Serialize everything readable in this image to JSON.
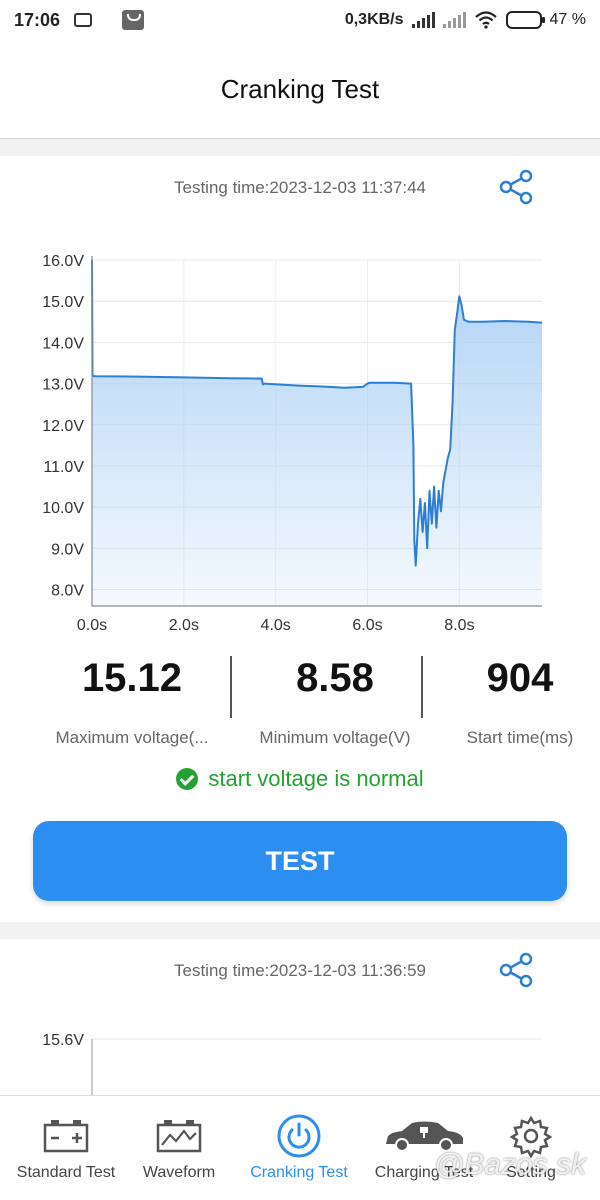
{
  "statusbar": {
    "time": "17:06",
    "net_speed": "0,3KB/s",
    "battery": "47 %"
  },
  "header": {
    "title": "Cranking Test"
  },
  "records": [
    {
      "testing_time": "Testing time:2023-12-03 11:37:44",
      "stats": {
        "max_value": "15.12",
        "max_label": "Maximum voltage(...",
        "min_value": "8.58",
        "min_label": "Minimum voltage(V)",
        "start_value": "904",
        "start_label": "Start time(ms)"
      },
      "status_text": "start voltage is normal",
      "test_button": "TEST"
    },
    {
      "testing_time": "Testing time:2023-12-03 11:36:59",
      "first_tick": "15.6V"
    }
  ],
  "chart_data": {
    "type": "area",
    "x_unit": "s",
    "y_unit": "V",
    "xlim": [
      0,
      9.8
    ],
    "ylim": [
      7.6,
      16.0
    ],
    "y_ticks": [
      "16.0V",
      "15.0V",
      "14.0V",
      "13.0V",
      "12.0V",
      "11.0V",
      "10.0V",
      "9.0V",
      "8.0V"
    ],
    "x_ticks": [
      "0.0s",
      "2.0s",
      "4.0s",
      "6.0s",
      "8.0s"
    ],
    "line_color": "#2b7fd4",
    "fill_color": "#a9cff5",
    "x": [
      0,
      0.01,
      0.05,
      1.0,
      2.0,
      3.0,
      3.7,
      3.72,
      3.75,
      4.5,
      5.0,
      5.5,
      5.9,
      6.0,
      6.05,
      6.6,
      6.95,
      7.0,
      7.02,
      7.05,
      7.1,
      7.15,
      7.2,
      7.25,
      7.3,
      7.35,
      7.4,
      7.45,
      7.5,
      7.55,
      7.6,
      7.65,
      7.7,
      7.75,
      7.8,
      7.85,
      7.9,
      7.95,
      8.0,
      8.05,
      8.1,
      8.2,
      8.5,
      9.0,
      9.5,
      9.8
    ],
    "y": [
      16.0,
      13.2,
      13.18,
      13.17,
      13.15,
      13.13,
      13.12,
      12.98,
      13.0,
      12.95,
      12.93,
      12.9,
      12.92,
      13.0,
      13.02,
      13.02,
      13.0,
      11.5,
      9.2,
      8.58,
      9.6,
      10.2,
      9.4,
      10.1,
      9.0,
      10.4,
      9.6,
      10.5,
      9.5,
      10.4,
      9.9,
      10.6,
      10.9,
      11.2,
      11.4,
      12.5,
      14.3,
      14.7,
      15.12,
      14.9,
      14.55,
      14.5,
      14.5,
      14.52,
      14.5,
      14.48
    ],
    "grid": true,
    "legend": "none"
  },
  "bottom_nav": [
    {
      "label": "Standard Test",
      "icon": "battery-icon"
    },
    {
      "label": "Waveform",
      "icon": "waveform-icon"
    },
    {
      "label": "Cranking Test",
      "icon": "power-icon"
    },
    {
      "label": "Charging Test",
      "icon": "car-charging-icon"
    },
    {
      "label": "Setting",
      "icon": "gear-icon"
    }
  ],
  "watermark": "@Bazos.sk",
  "colors": {
    "accent": "#2b8ef0",
    "ok": "#22a330"
  }
}
